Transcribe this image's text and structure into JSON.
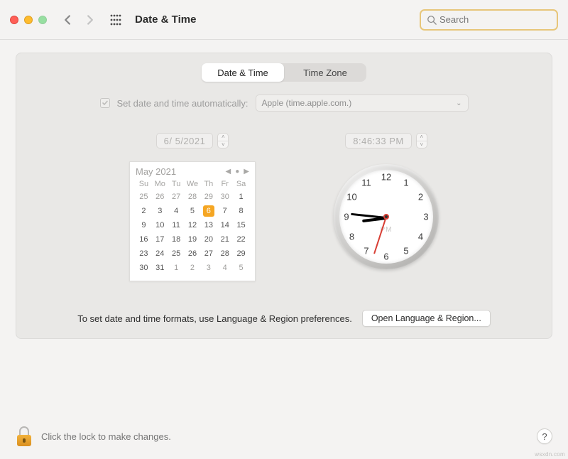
{
  "window": {
    "title": "Date & Time"
  },
  "search": {
    "placeholder": "Search"
  },
  "tabs": {
    "date_time": "Date & Time",
    "time_zone": "Time Zone",
    "active": "date_time"
  },
  "auto": {
    "label": "Set date and time automatically:",
    "checked": true,
    "server": "Apple (time.apple.com.)"
  },
  "date_field": {
    "value": "6/  5/2021"
  },
  "time_field": {
    "value": "8:46:33 PM"
  },
  "calendar": {
    "title": "May 2021",
    "dow": [
      "Su",
      "Mo",
      "Tu",
      "We",
      "Th",
      "Fr",
      "Sa"
    ],
    "weeks": [
      [
        {
          "n": 25
        },
        {
          "n": 26
        },
        {
          "n": 27
        },
        {
          "n": 28
        },
        {
          "n": 29
        },
        {
          "n": 30
        },
        {
          "n": 1,
          "in": true
        }
      ],
      [
        {
          "n": 2,
          "in": true
        },
        {
          "n": 3,
          "in": true
        },
        {
          "n": 4,
          "in": true
        },
        {
          "n": 5,
          "in": true
        },
        {
          "n": 6,
          "in": true,
          "sel": true
        },
        {
          "n": 7,
          "in": true
        },
        {
          "n": 8,
          "in": true
        }
      ],
      [
        {
          "n": 9,
          "in": true
        },
        {
          "n": 10,
          "in": true
        },
        {
          "n": 11,
          "in": true
        },
        {
          "n": 12,
          "in": true
        },
        {
          "n": 13,
          "in": true
        },
        {
          "n": 14,
          "in": true
        },
        {
          "n": 15,
          "in": true
        }
      ],
      [
        {
          "n": 16,
          "in": true
        },
        {
          "n": 17,
          "in": true
        },
        {
          "n": 18,
          "in": true
        },
        {
          "n": 19,
          "in": true
        },
        {
          "n": 20,
          "in": true
        },
        {
          "n": 21,
          "in": true
        },
        {
          "n": 22,
          "in": true
        }
      ],
      [
        {
          "n": 23,
          "in": true
        },
        {
          "n": 24,
          "in": true
        },
        {
          "n": 25,
          "in": true
        },
        {
          "n": 26,
          "in": true
        },
        {
          "n": 27,
          "in": true
        },
        {
          "n": 28,
          "in": true
        },
        {
          "n": 29,
          "in": true
        }
      ],
      [
        {
          "n": 30,
          "in": true
        },
        {
          "n": 31,
          "in": true
        },
        {
          "n": 1
        },
        {
          "n": 2
        },
        {
          "n": 3
        },
        {
          "n": 4
        },
        {
          "n": 5
        }
      ]
    ]
  },
  "clock": {
    "label": "PM",
    "hour": 8,
    "minute": 46,
    "second": 33,
    "numbers": [
      "12",
      "1",
      "2",
      "3",
      "4",
      "5",
      "6",
      "7",
      "8",
      "9",
      "10",
      "11"
    ]
  },
  "footer_hint": "To set date and time formats, use Language & Region preferences.",
  "open_lang_region": "Open Language & Region...",
  "lock_hint": "Click the lock to make changes.",
  "help": "?",
  "watermark": "wsxdn.com"
}
